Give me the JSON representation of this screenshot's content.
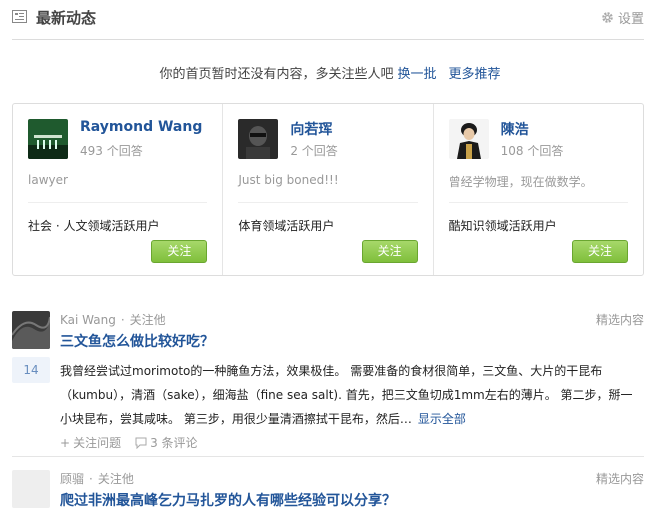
{
  "header": {
    "title": "最新动态",
    "settings_label": "设置"
  },
  "empty_tip": {
    "text": "你的首页暂时还没有内容，多关注些人吧",
    "refresh_link": "换一批",
    "more_link": "更多推荐"
  },
  "recommendations": [
    {
      "name": "Raymond Wang",
      "answers": "493 个回答",
      "bio": "lawyer",
      "tag": "社会 · 人文领域活跃用户",
      "follow_label": "关注"
    },
    {
      "name": "向若珲",
      "answers": "2 个回答",
      "bio": "Just big boned!!!",
      "tag": "体育领域活跃用户",
      "follow_label": "关注"
    },
    {
      "name": "陳浩",
      "answers": "108 个回答",
      "bio": "曾经学物理，现在做数学。",
      "tag": "酷知识领域活跃用户",
      "follow_label": "关注"
    }
  ],
  "feed": [
    {
      "author": "Kai Wang",
      "follow": "关注他",
      "badge": "精选内容",
      "question": "三文鱼怎么做比较好吃？",
      "votes": "14",
      "answer": "我曾经尝试过morimoto的一种腌鱼方法，效果极佳。 需要准备的食材很简单，三文鱼、大片的干昆布（kumbu），清酒（sake），细海盐（fine sea salt). 首先，把三文鱼切成1mm左右的薄片。 第二步，掰一小块昆布，尝其咸味。 第三步，用很少量清酒擦拭干昆布，然后…",
      "show_all": "显示全部",
      "follow_question": "关注问题",
      "comments": "3 条评论"
    },
    {
      "author": "顾骝",
      "follow": "关注他",
      "badge": "精选内容",
      "question": "爬过非洲最高峰乞力马扎罗的人有哪些经验可以分享？"
    }
  ]
}
